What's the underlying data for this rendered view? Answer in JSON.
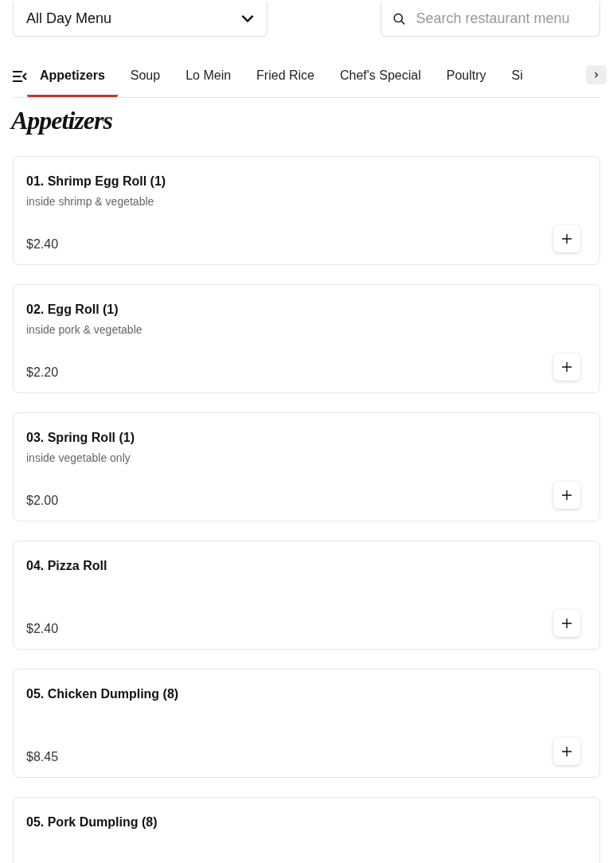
{
  "menu_select": {
    "value": "All Day Menu"
  },
  "search": {
    "placeholder": "Search restaurant menu"
  },
  "tabs": [
    {
      "label": "Appetizers",
      "selected": true
    },
    {
      "label": "Soup",
      "selected": false
    },
    {
      "label": "Lo Mein",
      "selected": false
    },
    {
      "label": "Fried Rice",
      "selected": false
    },
    {
      "label": "Chef's Special",
      "selected": false
    },
    {
      "label": "Poultry",
      "selected": false
    },
    {
      "label": "Si",
      "selected": false
    }
  ],
  "section_title": "Appetizers",
  "items": [
    {
      "name": "01. Shrimp Egg Roll (1)",
      "description": "inside shrimp & vegetable",
      "price": "$2.40"
    },
    {
      "name": "02. Egg Roll (1)",
      "description": "inside pork & vegetable",
      "price": "$2.20"
    },
    {
      "name": "03. Spring Roll (1)",
      "description": "inside vegetable only",
      "price": "$2.00"
    },
    {
      "name": "04. Pizza Roll",
      "price": "$2.40"
    },
    {
      "name": "05. Chicken Dumpling (8)",
      "price": "$8.45"
    },
    {
      "name": "05. Pork Dumpling (8)"
    }
  ]
}
